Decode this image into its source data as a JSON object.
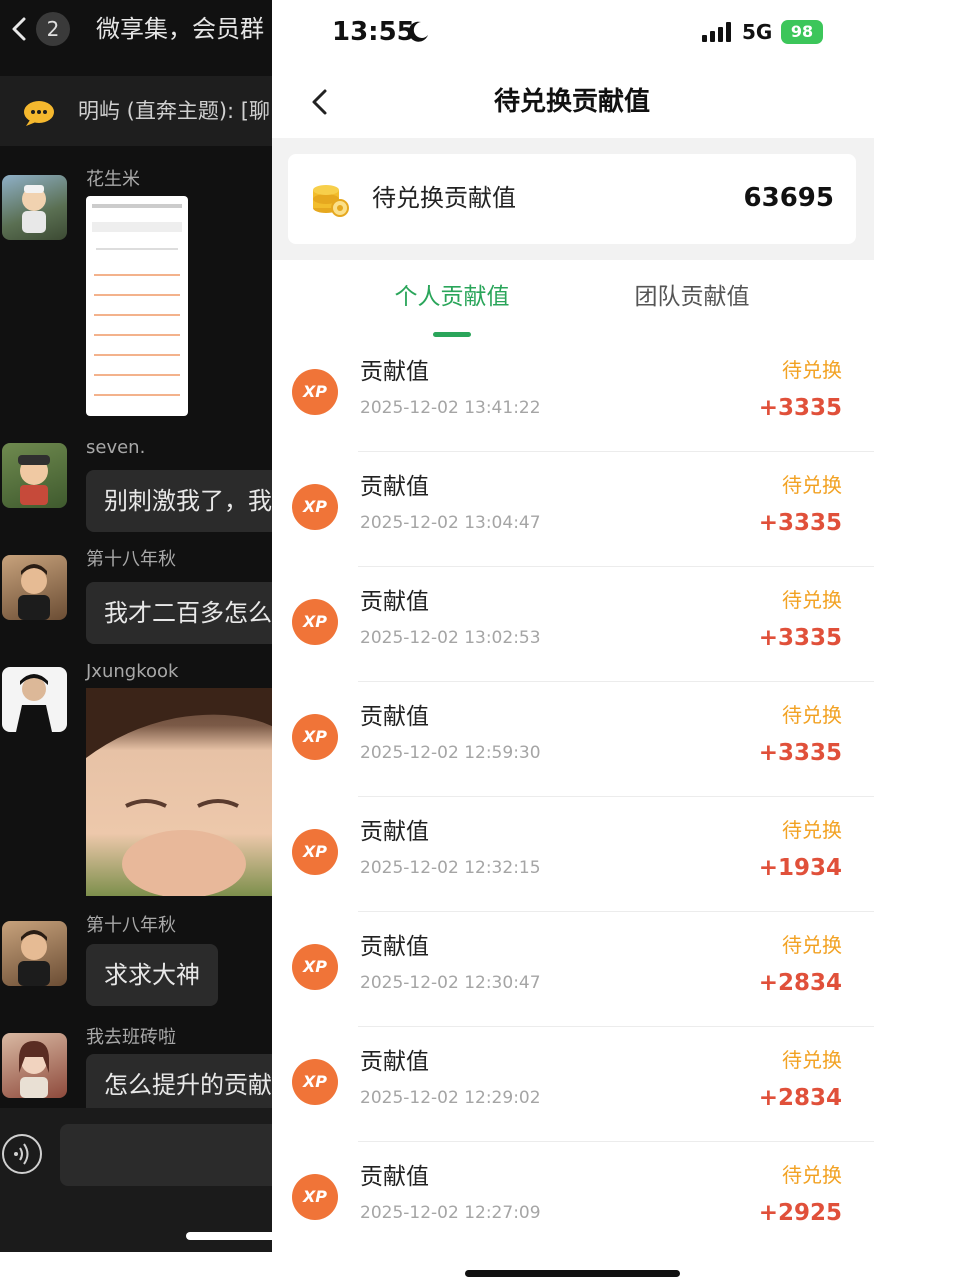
{
  "chat": {
    "unread_count": "2",
    "title": "微享集，会员群",
    "notice": "明屿 (直奔主题): [聊",
    "messages": [
      {
        "sender": "花生米",
        "text": ""
      },
      {
        "sender": "seven.",
        "text": "别刺激我了，我"
      },
      {
        "sender": "第十八年秋",
        "text": "我才二百多怎么"
      },
      {
        "sender": "Jxungkook",
        "text": ""
      },
      {
        "sender": "第十八年秋",
        "text": "求求大神"
      },
      {
        "sender": "我去班砖啦",
        "text": "怎么提升的贡献"
      }
    ]
  },
  "status_bar": {
    "time": "13:55",
    "network": "5G",
    "battery": "98"
  },
  "nav": {
    "title": "待兑换贡献值"
  },
  "summary": {
    "label": "待兑换贡献值",
    "value": "63695"
  },
  "tabs": [
    {
      "label": "个人贡献值",
      "active": true
    },
    {
      "label": "团队贡献值",
      "active": false
    }
  ],
  "colors": {
    "accent_green": "#2aa55a",
    "status_orange": "#f2a223",
    "amount_red": "#e0503a",
    "xp_icon": "#f07438"
  },
  "records": [
    {
      "icon": "XP",
      "title": "贡献值",
      "time": "2025-12-02 13:41:22",
      "status": "待兑换",
      "amount": "+3335"
    },
    {
      "icon": "XP",
      "title": "贡献值",
      "time": "2025-12-02 13:04:47",
      "status": "待兑换",
      "amount": "+3335"
    },
    {
      "icon": "XP",
      "title": "贡献值",
      "time": "2025-12-02 13:02:53",
      "status": "待兑换",
      "amount": "+3335"
    },
    {
      "icon": "XP",
      "title": "贡献值",
      "time": "2025-12-02 12:59:30",
      "status": "待兑换",
      "amount": "+3335"
    },
    {
      "icon": "XP",
      "title": "贡献值",
      "time": "2025-12-02 12:32:15",
      "status": "待兑换",
      "amount": "+1934"
    },
    {
      "icon": "XP",
      "title": "贡献值",
      "time": "2025-12-02 12:30:47",
      "status": "待兑换",
      "amount": "+2834"
    },
    {
      "icon": "XP",
      "title": "贡献值",
      "time": "2025-12-02 12:29:02",
      "status": "待兑换",
      "amount": "+2834"
    },
    {
      "icon": "XP",
      "title": "贡献值",
      "time": "2025-12-02 12:27:09",
      "status": "待兑换",
      "amount": "+2925"
    }
  ]
}
